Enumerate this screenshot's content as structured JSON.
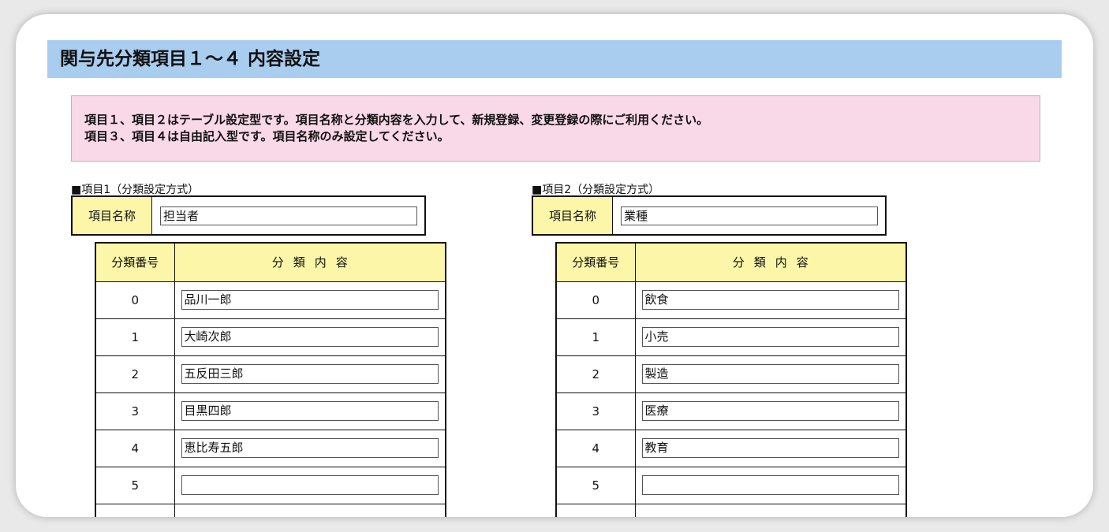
{
  "page_title": "関与先分類項目１～４ 内容設定",
  "notice": {
    "line1": "項目１、項目２はテーブル設定型です。項目名称と分類内容を入力して、新規登録、変更登録の際にご利用ください。",
    "line2": "項目３、項目４は自由記入型です。項目名称のみ設定してください。"
  },
  "item1": {
    "section_label": "■項目1（分類設定方式）",
    "name_label": "項目名称",
    "name_value": "担当者",
    "col_number": "分類番号",
    "col_content": "分類内容",
    "rows": [
      {
        "number": "0",
        "value": "品川一郎"
      },
      {
        "number": "1",
        "value": "大崎次郎"
      },
      {
        "number": "2",
        "value": "五反田三郎"
      },
      {
        "number": "3",
        "value": "目黒四郎"
      },
      {
        "number": "4",
        "value": "恵比寿五郎"
      },
      {
        "number": "5",
        "value": ""
      }
    ]
  },
  "item2": {
    "section_label": "■項目2（分類設定方式）",
    "name_label": "項目名称",
    "name_value": "業種",
    "col_number": "分類番号",
    "col_content": "分類内容",
    "rows": [
      {
        "number": "0",
        "value": "飲食"
      },
      {
        "number": "1",
        "value": "小売"
      },
      {
        "number": "2",
        "value": "製造"
      },
      {
        "number": "3",
        "value": "医療"
      },
      {
        "number": "4",
        "value": "教育"
      },
      {
        "number": "5",
        "value": ""
      }
    ]
  },
  "colors": {
    "title_bar": "#a9cdef",
    "notice_bg": "#f9d8e8",
    "label_bg": "#fbf6a8"
  }
}
